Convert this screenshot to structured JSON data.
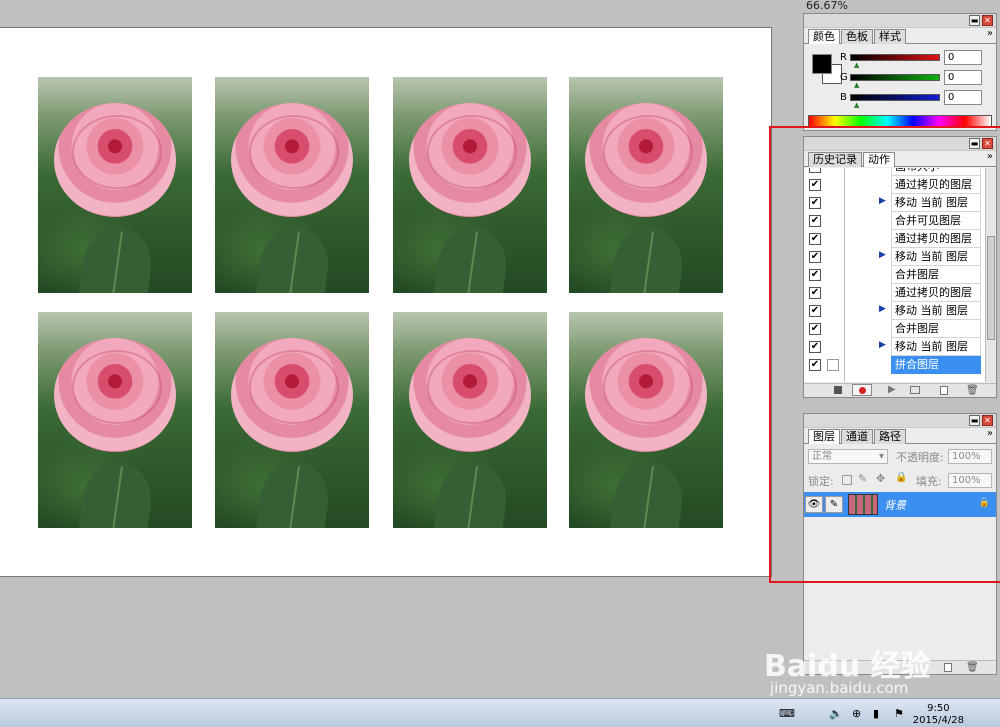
{
  "zoom": "66.67%",
  "canvas": {
    "photos": [
      {
        "name": "photo-1"
      },
      {
        "name": "photo-2"
      },
      {
        "name": "photo-3"
      },
      {
        "name": "photo-4"
      },
      {
        "name": "photo-5"
      },
      {
        "name": "photo-6"
      },
      {
        "name": "photo-7"
      },
      {
        "name": "photo-8"
      }
    ]
  },
  "color_panel": {
    "tabs": [
      "颜色",
      "色板",
      "样式"
    ],
    "active_tab": "颜色",
    "sliders": [
      {
        "label": "R",
        "value": "0",
        "color": "#e01010"
      },
      {
        "label": "G",
        "value": "0",
        "color": "#10b010"
      },
      {
        "label": "B",
        "value": "0",
        "color": "#1020d0"
      }
    ],
    "foreground": "#000000",
    "background": "#ffffff"
  },
  "actions_panel": {
    "tabs": [
      "历史记录",
      "动作"
    ],
    "active_tab": "动作",
    "rows": [
      {
        "label": "画布大小",
        "checked": true,
        "expand": true,
        "selected": false
      },
      {
        "label": "通过拷贝的图层",
        "checked": true,
        "expand": false,
        "selected": false
      },
      {
        "label": "移动 当前 图层",
        "checked": true,
        "expand": true,
        "selected": false
      },
      {
        "label": "合并可见图层",
        "checked": true,
        "expand": false,
        "selected": false
      },
      {
        "label": "通过拷贝的图层",
        "checked": true,
        "expand": false,
        "selected": false
      },
      {
        "label": "移动 当前 图层",
        "checked": true,
        "expand": true,
        "selected": false
      },
      {
        "label": "合并图层",
        "checked": true,
        "expand": false,
        "selected": false
      },
      {
        "label": "通过拷贝的图层",
        "checked": true,
        "expand": false,
        "selected": false
      },
      {
        "label": "移动 当前 图层",
        "checked": true,
        "expand": true,
        "selected": false
      },
      {
        "label": "合并图层",
        "checked": true,
        "expand": false,
        "selected": false
      },
      {
        "label": "移动 当前 图层",
        "checked": true,
        "expand": true,
        "selected": false
      },
      {
        "label": "拼合图层",
        "checked": true,
        "expand": false,
        "selected": true
      }
    ]
  },
  "layers_panel": {
    "tabs": [
      "图层",
      "通道",
      "路径"
    ],
    "active_tab": "图层",
    "blend_mode": "正常",
    "opacity_label": "不透明度:",
    "opacity_value": "100%",
    "lock_label": "锁定:",
    "fill_label": "填充:",
    "fill_value": "100%",
    "layer_name": "背景"
  },
  "taskbar": {
    "time": "9:50",
    "date": "2015/4/28"
  },
  "watermark": {
    "brand": "Baidu 经验",
    "url": "jingyan.baidu.com"
  },
  "icons": [
    "close-icon",
    "collapse-icon",
    "expand-triangle-icon",
    "eye-icon",
    "brush-icon",
    "lock-icon",
    "trash-icon",
    "new-icon",
    "record-icon",
    "play-icon",
    "stop-icon",
    "volume-icon",
    "network-icon",
    "keyboard-icon"
  ]
}
